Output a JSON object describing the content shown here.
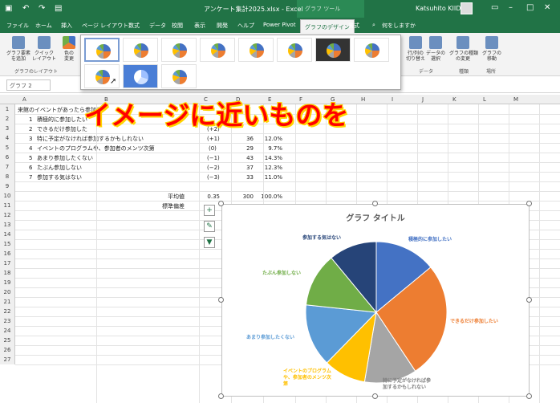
{
  "titlebar": {
    "doc_title": "アンケート集計2025.xlsx  -  Excel",
    "context_title": "グラフ ツール",
    "user": "Katsuhito KIIDA"
  },
  "tabs": [
    "ファイル",
    "ホーム",
    "挿入",
    "ページ レイアウト",
    "数式",
    "データ",
    "校閲",
    "表示",
    "開発",
    "ヘルプ",
    "Power Pivot",
    "グラフのデザイン",
    "書式",
    "何をしますか"
  ],
  "ribbon": {
    "add_element": "グラフ要素\nを追加",
    "quick_layout": "クイック\nレイアウト",
    "change_color": "色の\n変更",
    "layout_group": "グラフのレイアウト",
    "switch_row_col": "行/列の\n切り替え",
    "select_data": "データの\n選択",
    "data_group": "データ",
    "change_type": "グラフの種類\nの変更",
    "type_group": "種類",
    "move_chart": "グラフの\n移動",
    "location_group": "場所"
  },
  "namebox": "グラフ 2",
  "columns": [
    "A",
    "B",
    "C",
    "D",
    "E",
    "F",
    "G",
    "H",
    "I",
    "J",
    "K",
    "L",
    "M"
  ],
  "rows": [
    "1",
    "2",
    "3",
    "4",
    "5",
    "6",
    "7",
    "8",
    "9",
    "10",
    "11",
    "12",
    "13",
    "14",
    "15",
    "16",
    "17",
    "18",
    "19",
    "20",
    "21",
    "22",
    "23",
    "24",
    "25",
    "26",
    "27"
  ],
  "sheet": {
    "a1": "来館のイベントがあったら参加し",
    "items": [
      {
        "no": "1",
        "label": "積極的に参加したい",
        "score": "(+3)",
        "count": "42",
        "pct": ""
      },
      {
        "no": "2",
        "label": "できるだけ参加した",
        "score": "(+2)",
        "count": "",
        "pct": ""
      },
      {
        "no": "3",
        "label": "特に予定がなければ参加するかもしれない",
        "score": "(+1)",
        "count": "36",
        "pct": "12.0%"
      },
      {
        "no": "4",
        "label": "イベントのプログラムや、参加者のメンツ次第",
        "score": "(0)",
        "count": "29",
        "pct": "9.7%"
      },
      {
        "no": "5",
        "label": "あまり参加したくない",
        "score": "(−1)",
        "count": "43",
        "pct": "14.3%"
      },
      {
        "no": "6",
        "label": "たぶん参加しない",
        "score": "(−2)",
        "count": "37",
        "pct": "12.3%"
      },
      {
        "no": "7",
        "label": "参加する気はない",
        "score": "(−3)",
        "count": "33",
        "pct": "11.0%"
      }
    ],
    "avg_label": "平均値",
    "avg_value": "0.35",
    "total": "300",
    "total_pct": "100.0%",
    "sd_label": "標準偏差"
  },
  "banner": "イメージに近いものを",
  "chart_data": {
    "type": "pie",
    "title": "グラフ タイトル",
    "categories": [
      "積極的に参加したい",
      "できるだけ参加したい",
      "特に予定がなければ参加するかもしれない",
      "イベントのプログラムや、参加者のメンツ次第",
      "あまり参加したくない",
      "たぶん参加しない",
      "参加する気はない"
    ],
    "values": [
      42,
      80,
      36,
      29,
      43,
      37,
      33
    ],
    "colors": [
      "#4472c4",
      "#ed7d31",
      "#a5a5a5",
      "#ffc000",
      "#5b9bd5",
      "#70ad47",
      "#264478"
    ]
  },
  "chart_labels": {
    "s1": "積極的に参加したい",
    "s2": "できるだけ参加したい",
    "s3": "特に予定がなければ参\n加するかもしれない",
    "s4": "イベントのプログラム\nや、参加者のメンツ次\n第",
    "s5": "あまり参加したくない",
    "s6": "たぶん参加しない",
    "s7": "参加する気はない"
  },
  "side_buttons": {
    "elements": "+",
    "style": "✎",
    "filter": "▼"
  }
}
